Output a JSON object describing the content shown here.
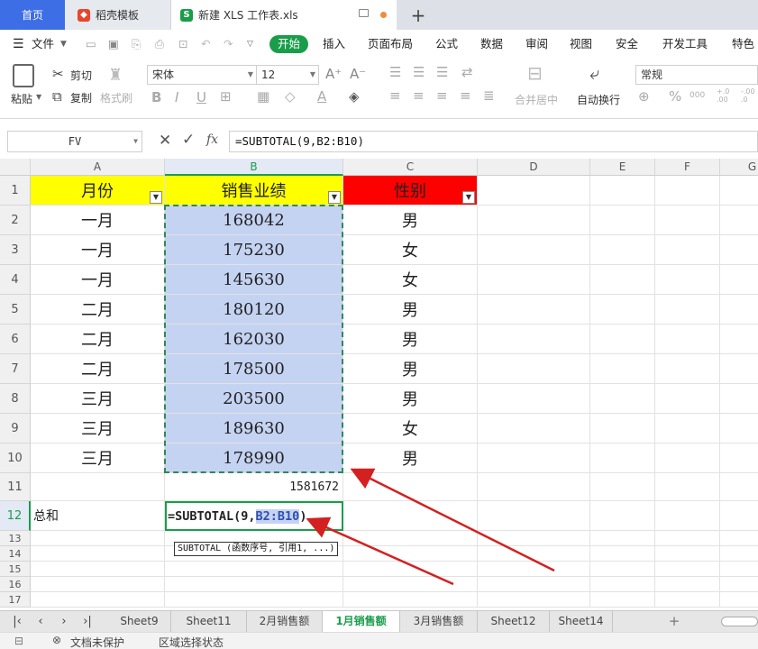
{
  "tabs": {
    "home": "首页",
    "daoke": "稻壳模板",
    "file": "新建 XLS 工作表.xls",
    "plus": "+"
  },
  "menu": {
    "file_menu": "文件",
    "items": [
      "开始",
      "插入",
      "页面布局",
      "公式",
      "数据",
      "审阅",
      "视图",
      "安全",
      "开发工具",
      "特色应"
    ]
  },
  "toolbar": {
    "paste": "粘贴",
    "cut": "剪切",
    "copy": "复制",
    "format_painter": "格式刷",
    "font_name": "宋体",
    "font_size": "12",
    "merge_center": "合并居中",
    "wrap_text": "自动换行",
    "number_format": "常规",
    "percent": "%",
    "comma_style": "000",
    "decimal_add": "+.0\n.00",
    "decimal_sub": "-.00\n.0"
  },
  "formula_bar": {
    "name_box": "FV",
    "fx": "fx",
    "formula": "=SUBTOTAL(9,B2:B10)"
  },
  "columns": [
    "A",
    "B",
    "C",
    "D",
    "E",
    "F",
    "G"
  ],
  "rows": [
    "1",
    "2",
    "3",
    "4",
    "5",
    "6",
    "7",
    "8",
    "9",
    "10",
    "11",
    "12",
    "13",
    "14",
    "15",
    "16",
    "17"
  ],
  "cells": {
    "header": [
      "月份",
      "销售业绩",
      "性别"
    ],
    "months": [
      "一月",
      "一月",
      "一月",
      "二月",
      "二月",
      "二月",
      "三月",
      "三月",
      "三月"
    ],
    "sales": [
      "168042",
      "175230",
      "145630",
      "180120",
      "162030",
      "178500",
      "203500",
      "189630",
      "178990"
    ],
    "gender": [
      "男",
      "女",
      "女",
      "男",
      "男",
      "男",
      "男",
      "女",
      "男"
    ],
    "total_value": "1581672",
    "label_sum": "总和",
    "formula_prefix": "=SUBTOTAL(9,",
    "formula_ref": "B2:B10",
    "formula_suffix": ")"
  },
  "tooltip": "SUBTOTAL (函数序号, 引用1, ...)",
  "sheets": [
    "Sheet9",
    "Sheet11",
    "2月销售额",
    "1月销售额",
    "3月销售额",
    "Sheet12",
    "Sheet14"
  ],
  "status": {
    "protect": "文档未保护",
    "mode": "区域选择状态"
  },
  "colors": {
    "accent": "#3d6ee6",
    "start_green": "#1a9d4b",
    "header_yellow": "#ffff00",
    "header_red": "#ff0000",
    "selection": "#c5d3f2",
    "arrow_red": "#d42020"
  }
}
